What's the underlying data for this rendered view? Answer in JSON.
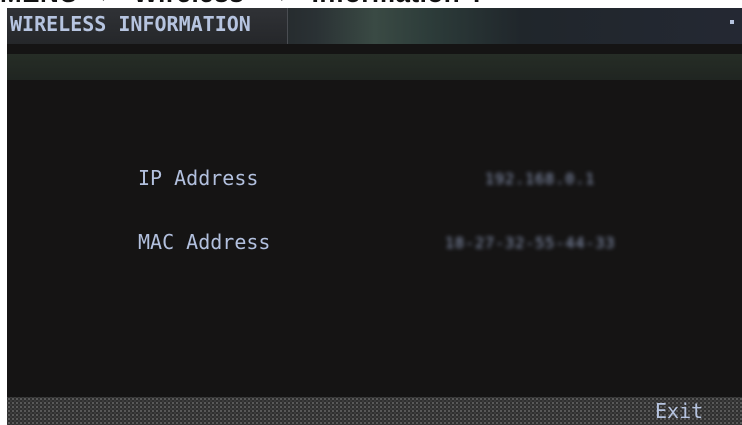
{
  "caption": "MENU → \"Wireless\" → \"Information\".",
  "header": {
    "title": "WIRELESS INFORMATION"
  },
  "info": {
    "rows": [
      {
        "label": "IP Address",
        "value": "192.168.0.1"
      },
      {
        "label": "MAC Address",
        "value": "18-27-32-55-44-33"
      }
    ]
  },
  "footer": {
    "exit_label": "Exit"
  },
  "colors": {
    "screen_background": "#151414",
    "text": "#b6c4e0",
    "footer_pattern": "#2a2a2a"
  }
}
